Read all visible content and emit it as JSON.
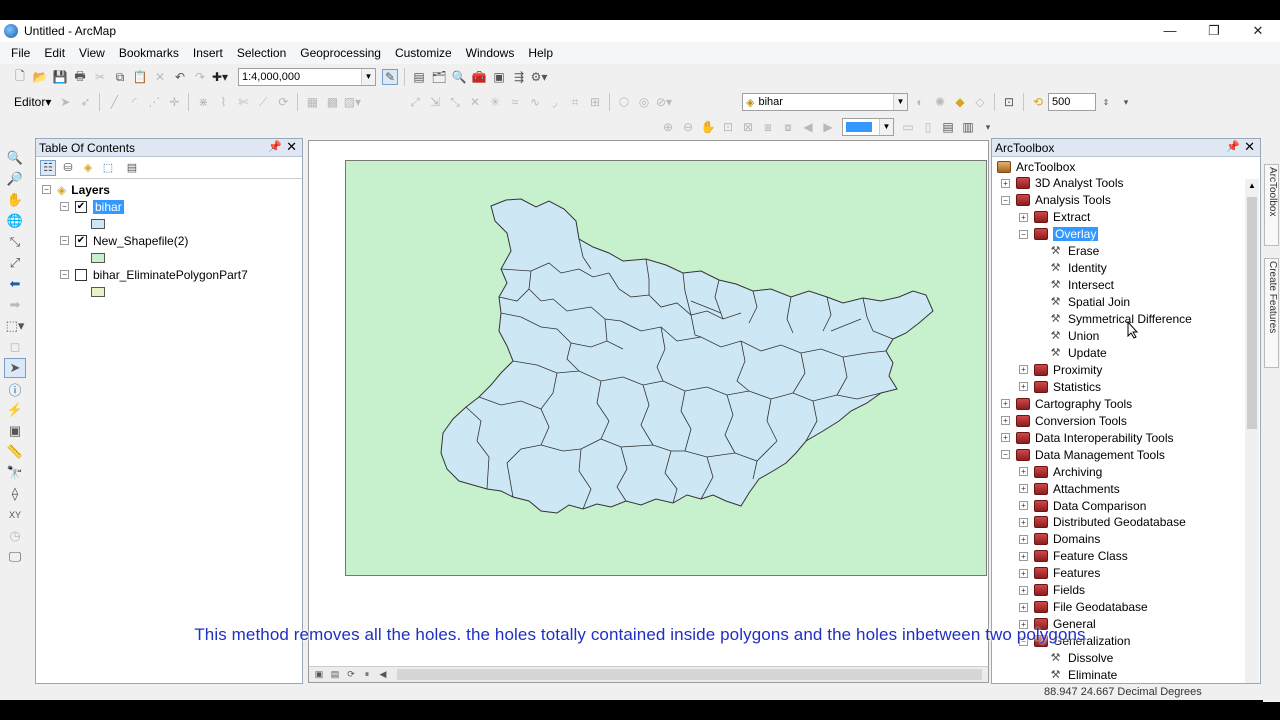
{
  "window": {
    "title": "Untitled - ArcMap",
    "controls": [
      "—",
      "❐",
      "✕"
    ]
  },
  "menu": [
    "File",
    "Edit",
    "View",
    "Bookmarks",
    "Insert",
    "Selection",
    "Geoprocessing",
    "Customize",
    "Windows",
    "Help"
  ],
  "standard_toolbar": {
    "scale": "1:4,000,000"
  },
  "editor": {
    "label": "Editor▾",
    "target_layer": "bihar",
    "tolerance": "500"
  },
  "toc": {
    "title": "Table Of Contents",
    "root": "Layers",
    "layers": [
      {
        "name": "bihar",
        "checked": "✔",
        "swatch": "#cde7f5",
        "selected": true
      },
      {
        "name": "New_Shapefile(2)",
        "checked": "✔",
        "swatch": "#c7f0cc",
        "selected": false
      },
      {
        "name": "bihar_EliminatePolygonPart7",
        "checked": "",
        "swatch": "#e6f3c4",
        "selected": false
      }
    ]
  },
  "toolbox": {
    "title": "ArcToolbox",
    "root": "ArcToolbox",
    "items": [
      {
        "label": "3D Analyst Tools",
        "level": 1,
        "kind": "box",
        "exp": "+"
      },
      {
        "label": "Analysis Tools",
        "level": 1,
        "kind": "box",
        "exp": "−"
      },
      {
        "label": "Extract",
        "level": 2,
        "kind": "box",
        "exp": "+"
      },
      {
        "label": "Overlay",
        "level": 2,
        "kind": "box",
        "exp": "−",
        "selected": true
      },
      {
        "label": "Erase",
        "level": 3,
        "kind": "tool"
      },
      {
        "label": "Identity",
        "level": 3,
        "kind": "tool"
      },
      {
        "label": "Intersect",
        "level": 3,
        "kind": "tool"
      },
      {
        "label": "Spatial Join",
        "level": 3,
        "kind": "tool"
      },
      {
        "label": "Symmetrical Difference",
        "level": 3,
        "kind": "tool"
      },
      {
        "label": "Union",
        "level": 3,
        "kind": "tool"
      },
      {
        "label": "Update",
        "level": 3,
        "kind": "tool"
      },
      {
        "label": "Proximity",
        "level": 2,
        "kind": "box",
        "exp": "+"
      },
      {
        "label": "Statistics",
        "level": 2,
        "kind": "box",
        "exp": "+"
      },
      {
        "label": "Cartography Tools",
        "level": 1,
        "kind": "box",
        "exp": "+"
      },
      {
        "label": "Conversion Tools",
        "level": 1,
        "kind": "box",
        "exp": "+"
      },
      {
        "label": "Data Interoperability Tools",
        "level": 1,
        "kind": "box",
        "exp": "+"
      },
      {
        "label": "Data Management Tools",
        "level": 1,
        "kind": "box",
        "exp": "−"
      },
      {
        "label": "Archiving",
        "level": 2,
        "kind": "box",
        "exp": "+"
      },
      {
        "label": "Attachments",
        "level": 2,
        "kind": "box",
        "exp": "+"
      },
      {
        "label": "Data Comparison",
        "level": 2,
        "kind": "box",
        "exp": "+"
      },
      {
        "label": "Distributed Geodatabase",
        "level": 2,
        "kind": "box",
        "exp": "+"
      },
      {
        "label": "Domains",
        "level": 2,
        "kind": "box",
        "exp": "+"
      },
      {
        "label": "Feature Class",
        "level": 2,
        "kind": "box",
        "exp": "+"
      },
      {
        "label": "Features",
        "level": 2,
        "kind": "box",
        "exp": "+"
      },
      {
        "label": "Fields",
        "level": 2,
        "kind": "box",
        "exp": "+"
      },
      {
        "label": "File Geodatabase",
        "level": 2,
        "kind": "box",
        "exp": "+"
      },
      {
        "label": "General",
        "level": 2,
        "kind": "box",
        "exp": "+"
      },
      {
        "label": "Generalization",
        "level": 2,
        "kind": "box",
        "exp": "−"
      },
      {
        "label": "Dissolve",
        "level": 3,
        "kind": "tool"
      },
      {
        "label": "Eliminate",
        "level": 3,
        "kind": "tool"
      }
    ]
  },
  "side_tabs": [
    "ArcToolbox",
    "Create Features"
  ],
  "caption": "This method removes all the holes. the holes totally contained inside polygons and the holes inbetween two polygons",
  "status": {
    "coordinates": "88.947  24.667 Decimal Degrees"
  },
  "colors": {
    "page_fill": "#c7f0cc",
    "polygon_fill": "#cde7f5",
    "selection": "#3399ff",
    "caption": "#1f2fc4"
  }
}
